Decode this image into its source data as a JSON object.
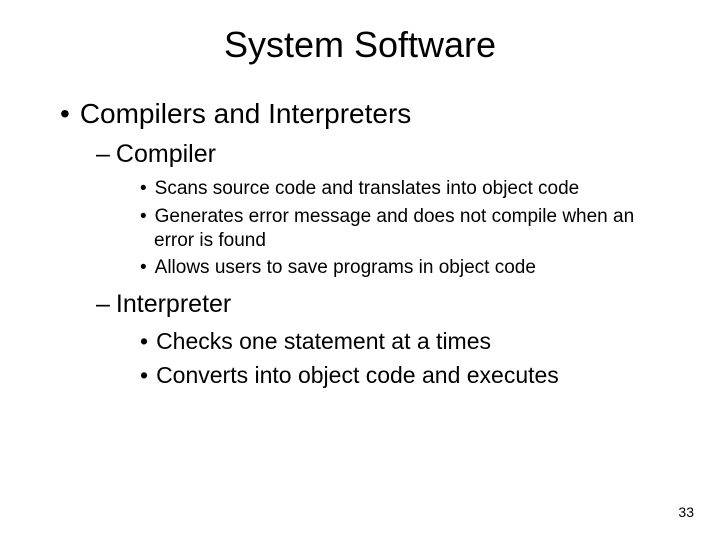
{
  "title": "System Software",
  "l1_heading": "Compilers and Interpreters",
  "compiler": {
    "heading": "Compiler",
    "points": [
      "Scans source code and translates into object code",
      "Generates error message and does not compile when an error is found",
      "Allows users to save programs in object code"
    ]
  },
  "interpreter": {
    "heading": "Interpreter",
    "points": [
      "Checks one statement at a times",
      "Converts into object code and executes"
    ]
  },
  "page_number": "33"
}
